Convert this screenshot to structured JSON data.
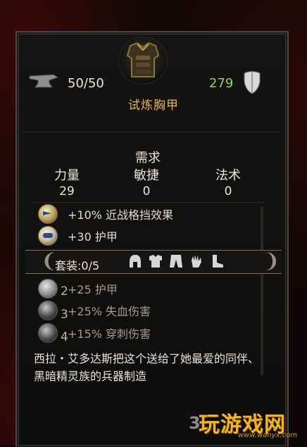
{
  "item": {
    "durability": "50/50",
    "armor_value": "279",
    "name": "试炼胸甲"
  },
  "requirements": {
    "title": "需求",
    "stats": [
      {
        "label": "力量",
        "value": "29"
      },
      {
        "label": "敏捷",
        "value": "0"
      },
      {
        "label": "法术",
        "value": "0"
      }
    ]
  },
  "bonuses": [
    {
      "text": "+10% 近战格挡效果"
    },
    {
      "text": "+30 护甲"
    }
  ],
  "set": {
    "label": "套装:0/5",
    "pieces": [
      "helm-icon",
      "chest-icon",
      "legs-icon",
      "gloves-icon",
      "boots-icon"
    ],
    "bonuses": [
      {
        "count": "2",
        "text": "+25 护甲"
      },
      {
        "count": "3",
        "text": "+25% 失血伤害"
      },
      {
        "count": "4",
        "text": "+15% 穿刺伤害"
      }
    ]
  },
  "description": "西拉・艾多达斯把这个送给了她最爱的同伴、黑暗精灵族的兵器制造",
  "watermark": {
    "number": "3",
    "name": "玩游戏网",
    "url": "www.wanyx.com"
  },
  "colors": {
    "item_name": "#e2b25a",
    "armor_value": "#8fd46a",
    "watermark": "#f2b421"
  }
}
